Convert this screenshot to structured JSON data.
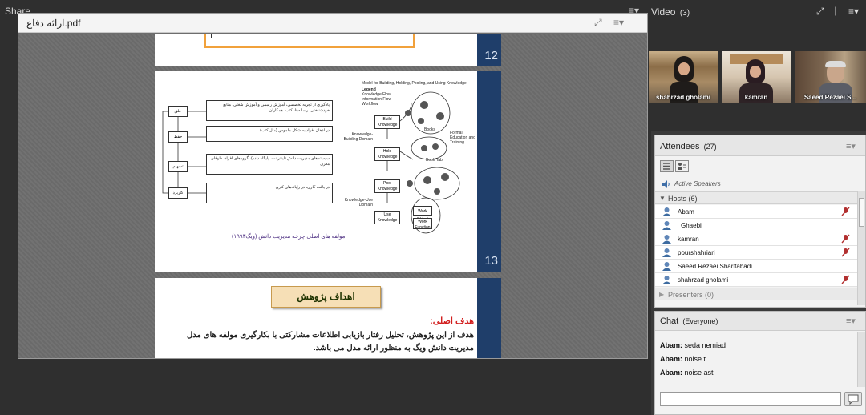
{
  "share": {
    "title": "Share",
    "document_title": "ارائه دفاع.pdf",
    "slides": {
      "s12": {
        "number": "12"
      },
      "s13": {
        "number": "13",
        "flow_boxes": [
          "خلق",
          "حفظ",
          "تسهیم",
          "کاربرد"
        ],
        "descriptions": [
          "یادگیری از تجربه تخصصی، آموزش رسمی و آموزش شغلی، منابع خودشناختی، رسانه‌ها، کتب، همکاران",
          "در اذهان افراد به شکل ملموس (مثل کتب)",
          "سیستم‌های مدیریت دانش (اینترانت، پایگاه داده)، گروه‌های افراد، طوفان مغزی",
          "در یافت کاری، در رایانه‌های کاری"
        ],
        "diagram_title": "Model for Building, Holding, Pooling, and Using Knowledge",
        "legend_title": "Legend",
        "legend_items": [
          "Knowledge Flow",
          "Information Flow",
          "Workflow"
        ],
        "knowledge_boxes": [
          "Build Knowledge",
          "Hold Knowledge",
          "Pool Knowledge",
          "Use Knowledge"
        ],
        "domains": [
          "Knowledge-Building Domain",
          "Knowledge-Use Domain"
        ],
        "side_labels": [
          "Books",
          "Book Tab",
          "Formal Education and Training",
          "Work Object",
          "Work Function"
        ],
        "caption": "مولفه های اصلی چرخه مدیریت دانش (ویگ۱۹۹۳)"
      },
      "s14": {
        "banner": "اهداف پژوهش",
        "heading": "هدف اصلی:",
        "text": "هدف از این پژوهش، تحلیل رفتار بازیابی اطلاعات مشارکتی با بکارگیری مولفه های مدل مدیریت دانش ویگ به منظور ارائه مدل می باشد."
      }
    }
  },
  "video": {
    "title": "Video",
    "count": "(3)",
    "cams": [
      {
        "name": "shahrzad gholami"
      },
      {
        "name": "kamran"
      },
      {
        "name": "Saeed Rezaei S..."
      }
    ]
  },
  "attendees": {
    "title": "Attendees",
    "count": "(27)",
    "active_speakers": "Active Speakers",
    "hosts_label": "Hosts (6)",
    "hosts": [
      "Abam",
      "Ghaebi",
      "kamran",
      "pourshahriari",
      "Saeed Rezaei Sharifabadi",
      "shahrzad gholami"
    ],
    "presenters_label": "Presenters (0)"
  },
  "chat": {
    "title": "Chat",
    "scope": "(Everyone)",
    "messages": [
      {
        "author": "Abam:",
        "text": "seda nemiad"
      },
      {
        "author": "Abam:",
        "text": "noise t"
      },
      {
        "author": "Abam:",
        "text": "noise ast"
      }
    ],
    "input_value": ""
  },
  "colors": {
    "slide_bar": "#1f3e6a",
    "goal_heading": "#d21f1f",
    "caption": "#4b2c80",
    "banner": "#f6dfb6"
  }
}
